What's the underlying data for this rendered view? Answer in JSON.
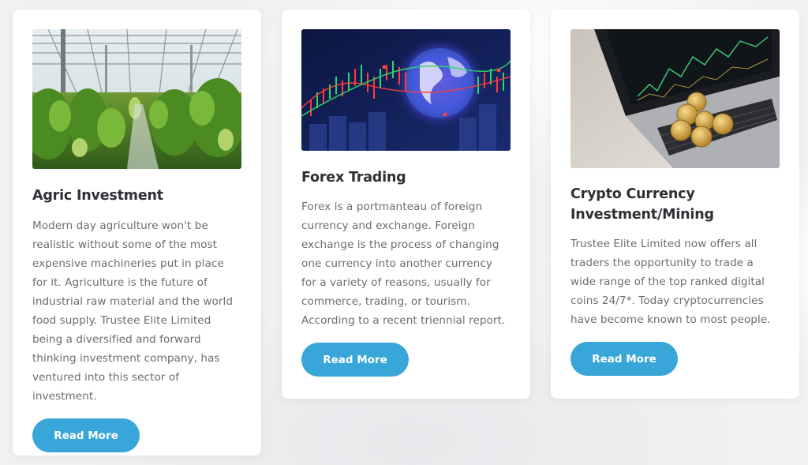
{
  "colors": {
    "background": "#f1f1f3",
    "card": "#ffffff",
    "title": "#2f2f36",
    "body_text": "#6d6d72",
    "button": "#39a6d9",
    "button_text": "#ffffff"
  },
  "cards": [
    {
      "image_alt": "greenhouse-crops-image",
      "title": "Agric Investment",
      "text": "Modern day agriculture won't be realistic without some of the most expensive machineries put in place for it. Agriculture is the future of industrial raw material and the world food supply. Trustee Elite Limited being a diversified and forward thinking investment company, has ventured into this sector of investment.",
      "button_label": "Read More"
    },
    {
      "image_alt": "forex-chart-globe-image",
      "title": "Forex Trading",
      "text": "Forex is a portmanteau of foreign currency and exchange. Foreign exchange is the process of changing one currency into another currency for a variety of reasons, usually for commerce, trading, or tourism. According to a recent triennial report.",
      "button_label": "Read More"
    },
    {
      "image_alt": "laptop-bitcoins-image",
      "title": "Crypto Currency Investment/Mining",
      "text": "Trustee Elite Limited now offers all traders the opportunity to trade a wide range of the top ranked digital coins 24/7*. Today cryptocurrencies have become known to most people.",
      "button_label": "Read More"
    }
  ]
}
